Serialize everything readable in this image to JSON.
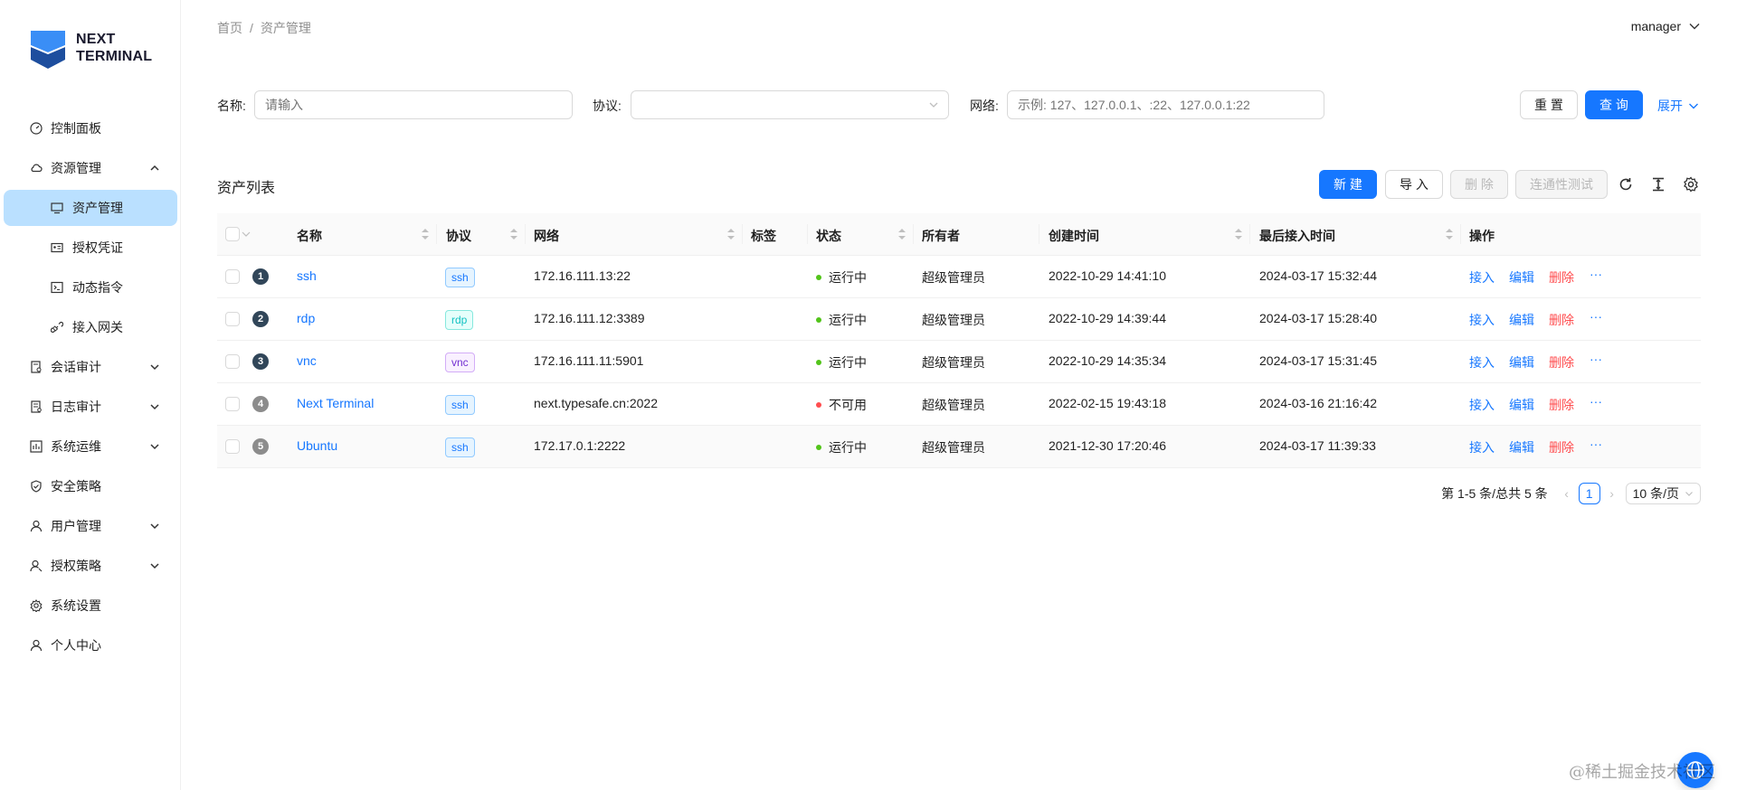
{
  "logo": {
    "line1": "NEXT",
    "line2": "TERMINAL"
  },
  "sidebar": {
    "items": [
      {
        "label": "控制面板",
        "icon": "dashboard-icon"
      },
      {
        "label": "资源管理",
        "icon": "cloud-icon",
        "expanded": true
      },
      {
        "label": "会话审计",
        "icon": "audit-icon"
      },
      {
        "label": "日志审计",
        "icon": "log-icon"
      },
      {
        "label": "系统运维",
        "icon": "ops-icon"
      },
      {
        "label": "安全策略",
        "icon": "shield-icon"
      },
      {
        "label": "用户管理",
        "icon": "user-icon"
      },
      {
        "label": "授权策略",
        "icon": "user-auth-icon"
      },
      {
        "label": "系统设置",
        "icon": "gear-icon"
      },
      {
        "label": "个人中心",
        "icon": "user-icon"
      }
    ],
    "sub_items": [
      {
        "label": "资产管理",
        "icon": "desktop-icon",
        "active": true
      },
      {
        "label": "授权凭证",
        "icon": "id-card-icon"
      },
      {
        "label": "动态指令",
        "icon": "terminal-icon"
      },
      {
        "label": "接入网关",
        "icon": "link-icon"
      }
    ]
  },
  "breadcrumb": {
    "home": "首页",
    "sep": "/",
    "current": "资产管理"
  },
  "user": {
    "name": "manager"
  },
  "search": {
    "name_label": "名称:",
    "name_placeholder": "请输入",
    "protocol_label": "协议:",
    "network_label": "网络:",
    "network_placeholder": "示例: 127、127.0.0.1、:22、127.0.0.1:22",
    "reset_label": "重 置",
    "query_label": "查 询",
    "expand_label": "展开"
  },
  "table": {
    "title": "资产列表",
    "toolbar": {
      "new_label": "新 建",
      "import_label": "导 入",
      "delete_label": "删 除",
      "connectivity_label": "连通性测试"
    },
    "columns": {
      "name": "名称",
      "protocol": "协议",
      "network": "网络",
      "tags": "标签",
      "status": "状态",
      "owner": "所有者",
      "created": "创建时间",
      "last_access": "最后接入时间",
      "actions": "操作"
    },
    "rows": [
      {
        "index": "1",
        "name": "ssh",
        "protocol": "ssh",
        "network": "172.16.111.13:22",
        "status": "运行中",
        "owner": "超级管理员",
        "created": "2022-10-29 14:41:10",
        "last_access": "2024-03-17 15:32:44"
      },
      {
        "index": "2",
        "name": "rdp",
        "protocol": "rdp",
        "network": "172.16.111.12:3389",
        "status": "运行中",
        "owner": "超级管理员",
        "created": "2022-10-29 14:39:44",
        "last_access": "2024-03-17 15:28:40"
      },
      {
        "index": "3",
        "name": "vnc",
        "protocol": "vnc",
        "network": "172.16.111.11:5901",
        "status": "运行中",
        "owner": "超级管理员",
        "created": "2022-10-29 14:35:34",
        "last_access": "2024-03-17 15:31:45"
      },
      {
        "index": "4",
        "name": "Next Terminal",
        "protocol": "ssh",
        "network": "next.typesafe.cn:2022",
        "status": "不可用",
        "owner": "超级管理员",
        "created": "2022-02-15 19:43:18",
        "last_access": "2024-03-16 21:16:42"
      },
      {
        "index": "5",
        "name": "Ubuntu",
        "protocol": "ssh",
        "network": "172.17.0.1:2222",
        "status": "运行中",
        "owner": "超级管理员",
        "created": "2021-12-30 17:20:46",
        "last_access": "2024-03-17 11:39:33"
      }
    ],
    "action_labels": {
      "connect": "接入",
      "edit": "编辑",
      "delete": "删除",
      "more": "···"
    }
  },
  "pagination": {
    "summary": "第 1-5 条/总共 5 条",
    "current": "1",
    "page_size": "10 条/页"
  },
  "watermark": "@稀土掘金技术社区",
  "colors": {
    "primary": "#1677ff",
    "danger": "#ff4d4f",
    "success": "#52c41a",
    "active_menu_bg": "#bae0ff"
  }
}
